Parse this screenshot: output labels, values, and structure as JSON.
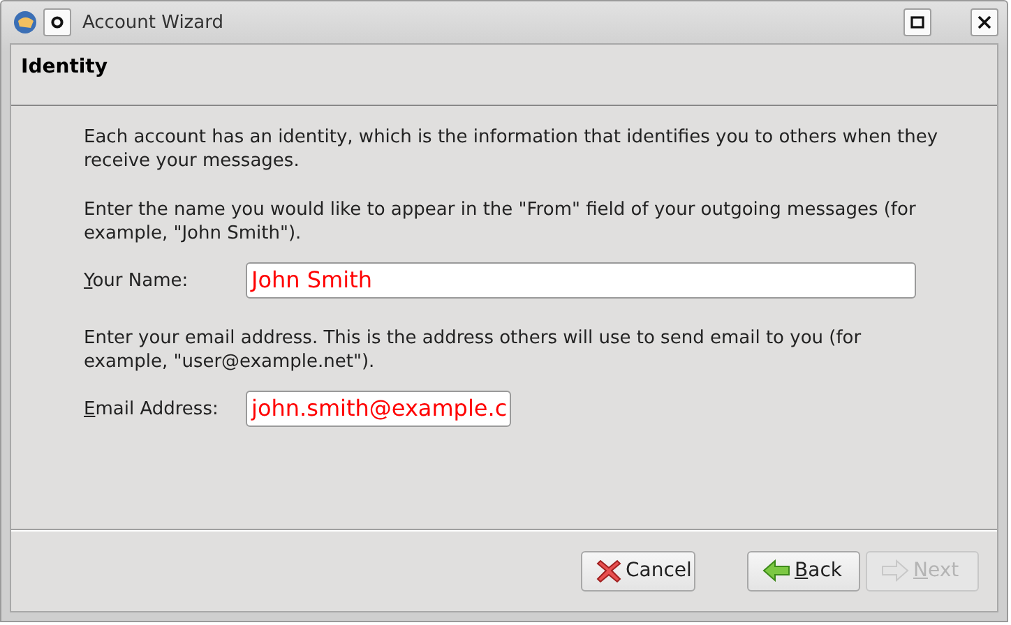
{
  "window": {
    "title": "Account Wizard"
  },
  "page": {
    "title": "Identity"
  },
  "paragraphs": [
    "Each account has an identity, which is the information that identifies you to others when they receive your messages."
  ],
  "fields": [
    {
      "intro": "Enter the name you would like to appear in the \"From\" field of your outgoing messages (for example, \"John Smith\").",
      "label": "Your Name:",
      "mnemonic": true,
      "value": "John Smith"
    },
    {
      "intro": "Enter your email address. This is the address others will use to send email to you (for example, \"user@example.net\").",
      "label": "Email Address:",
      "mnemonic": true,
      "value": "john.smith@example.c"
    }
  ],
  "buttons": [
    {
      "kind": "cancel",
      "label": "Cancel",
      "mnemonic": false,
      "disabled": false
    },
    {
      "kind": "back",
      "label": "Back",
      "mnemonic": true,
      "disabled": false
    },
    {
      "kind": "next",
      "label": "Next",
      "mnemonic": true,
      "disabled": true
    }
  ]
}
